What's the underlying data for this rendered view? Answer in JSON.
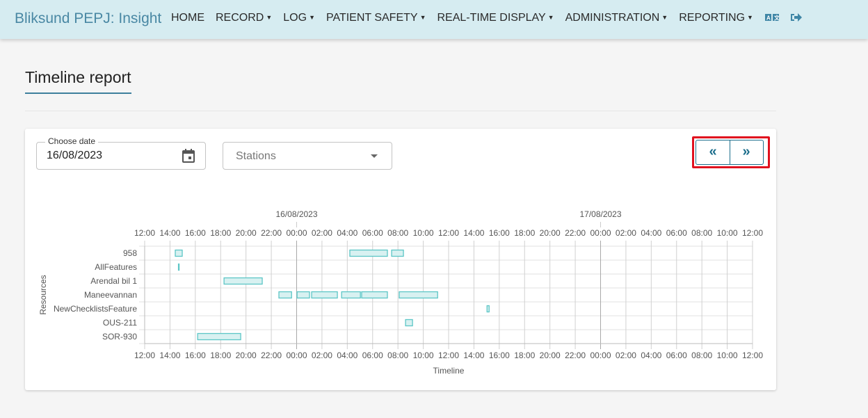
{
  "navbar": {
    "brand": "Bliksund PEPJ: Insight",
    "items": [
      {
        "label": "HOME",
        "dropdown": false
      },
      {
        "label": "RECORD",
        "dropdown": true
      },
      {
        "label": "LOG",
        "dropdown": true
      },
      {
        "label": "PATIENT SAFETY",
        "dropdown": true
      },
      {
        "label": "REAL-TIME DISPLAY",
        "dropdown": true
      },
      {
        "label": "ADMINISTRATION",
        "dropdown": true
      },
      {
        "label": "REPORTING",
        "dropdown": true
      }
    ],
    "icons": [
      "language-icon",
      "logout-icon"
    ],
    "background": "#d6ecf1"
  },
  "page": {
    "title": "Timeline report"
  },
  "filters": {
    "date_label": "Choose date",
    "date_value": "16/08/2023",
    "stations_placeholder": "Stations",
    "prev_label": "«",
    "next_label": "»"
  },
  "chart_data": {
    "type": "timeline",
    "xlabel": "Timeline",
    "ylabel": "Resources",
    "xlim": [
      "2023-08-15T12:00",
      "2023-08-17T12:00"
    ],
    "date_labels": [
      "16/08/2023",
      "17/08/2023"
    ],
    "tick_labels": [
      "12:00",
      "14:00",
      "16:00",
      "18:00",
      "20:00",
      "22:00",
      "00:00",
      "02:00",
      "04:00",
      "06:00",
      "08:00",
      "10:00",
      "12:00",
      "14:00",
      "16:00",
      "18:00",
      "20:00",
      "22:00",
      "00:00",
      "02:00",
      "04:00",
      "06:00",
      "08:00",
      "10:00",
      "12:00"
    ],
    "grid": true,
    "bar_color": "#5cc6c6",
    "resources": [
      "958",
      "AllFeatures",
      "Arendal bil 1",
      "Maneevannan",
      "NewChecklistsFeature",
      "OUS-211",
      "SOR-930"
    ],
    "events": [
      {
        "resource": "958",
        "start": "2023-08-15T14:25",
        "end": "2023-08-15T14:58"
      },
      {
        "resource": "958",
        "start": "2023-08-16T04:12",
        "end": "2023-08-16T07:10"
      },
      {
        "resource": "958",
        "start": "2023-08-16T07:30",
        "end": "2023-08-16T08:26"
      },
      {
        "resource": "AllFeatures",
        "start": "2023-08-15T14:40",
        "end": "2023-08-15T14:42"
      },
      {
        "resource": "Arendal bil 1",
        "start": "2023-08-15T18:16",
        "end": "2023-08-15T21:17"
      },
      {
        "resource": "Maneevannan",
        "start": "2023-08-15T22:36",
        "end": "2023-08-15T23:36"
      },
      {
        "resource": "Maneevannan",
        "start": "2023-08-16T00:02",
        "end": "2023-08-16T01:01"
      },
      {
        "resource": "Maneevannan",
        "start": "2023-08-16T01:11",
        "end": "2023-08-16T03:13"
      },
      {
        "resource": "Maneevannan",
        "start": "2023-08-16T03:33",
        "end": "2023-08-16T05:02"
      },
      {
        "resource": "Maneevannan",
        "start": "2023-08-16T05:08",
        "end": "2023-08-16T07:10"
      },
      {
        "resource": "Maneevannan",
        "start": "2023-08-16T08:06",
        "end": "2023-08-16T11:08"
      },
      {
        "resource": "NewChecklistsFeature",
        "start": "2023-08-16T15:02",
        "end": "2023-08-16T15:12"
      },
      {
        "resource": "OUS-211",
        "start": "2023-08-16T08:36",
        "end": "2023-08-16T09:09"
      },
      {
        "resource": "SOR-930",
        "start": "2023-08-15T16:11",
        "end": "2023-08-15T19:35"
      }
    ]
  }
}
